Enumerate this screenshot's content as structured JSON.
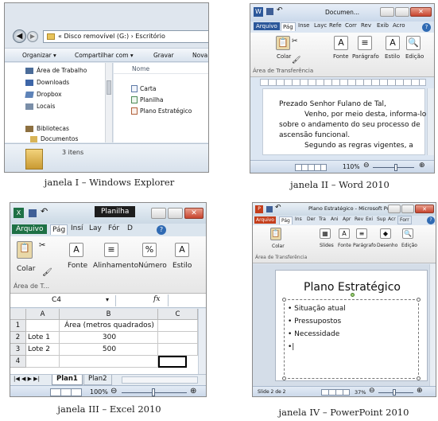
{
  "explorer": {
    "address": "« Disco removível (G:) › Escritório",
    "toolbar": [
      "Organizar ▾",
      "Compartilhar com ▾",
      "Gravar",
      "Nova"
    ],
    "nav": [
      "Área de Trabalho",
      "Downloads",
      "Dropbox",
      "Locais"
    ],
    "nav_libraries": "Bibliotecas",
    "nav_documents": "Documentos",
    "column_name": "Nome",
    "files": [
      "Carta",
      "Planilha",
      "Plano Estratégico"
    ],
    "status": "3 itens",
    "caption": "janela I – Windows Explorer"
  },
  "word": {
    "title": "Documen...",
    "tabs": [
      "Arquivo",
      "Pág",
      "Inse",
      "Layc",
      "Refe",
      "Corr",
      "Rev",
      "Exib",
      "Acro"
    ],
    "ribbon": {
      "paste": "Colar",
      "font": "Fonte",
      "paragraph": "Parágrafo",
      "style": "Estilo",
      "edit": "Edição",
      "clipboard": "Área de Transferência"
    },
    "body_lines": [
      "Prezado Senhor Fulano de Tal,",
      "Venho, por meio desta, informa-lo",
      "sobre o andamento do seu processo de",
      "ascensão funcional.",
      "Segundo as regras vigentes, a"
    ],
    "zoom": "110%",
    "caption": "janela II – Word 2010"
  },
  "excel": {
    "title": "Planilha",
    "tabs": [
      "Arquivo",
      "Pág",
      "Insí",
      "Lay",
      "Fór",
      "D"
    ],
    "ribbon": {
      "paste": "Colar",
      "font": "Fonte",
      "alignment": "Alinhamento",
      "number": "Número",
      "style": "Estilo",
      "clipboard": "Área de T..."
    },
    "namebox": "C4",
    "fx": "fx",
    "columns": [
      "A",
      "B",
      "C"
    ],
    "rows": [
      {
        "n": "1",
        "a": "",
        "b": "Área (metros quadrados)",
        "c": ""
      },
      {
        "n": "2",
        "a": "Lote 1",
        "b": "300",
        "c": ""
      },
      {
        "n": "3",
        "a": "Lote 2",
        "b": "500",
        "c": ""
      },
      {
        "n": "4",
        "a": "",
        "b": "",
        "c": ""
      }
    ],
    "sheets": [
      "Plan1",
      "Plan2"
    ],
    "zoom": "100%",
    "caption": "janela III – Excel 2010"
  },
  "ppt": {
    "title": "Plano Estratégico - Microsoft Po...",
    "tabs": [
      "Arquivo",
      "Pág",
      "Ins",
      "Der",
      "Tra",
      "Ani",
      "Apr",
      "Rev",
      "Exi",
      "Sup",
      "Acr",
      "Forr"
    ],
    "ribbon": {
      "paste": "Colar",
      "slides": "Slides",
      "font": "Fonte",
      "paragraph": "Parágrafo",
      "drawing": "Desenho",
      "edit": "Edição",
      "clipboard": "Área de Transferência"
    },
    "slide_title": "Plano Estratégico",
    "bullets": [
      "Situação atual",
      "Pressupostos",
      "Necessidade"
    ],
    "status": "Slide 2 de 2",
    "zoom": "37%",
    "caption": "janela IV – PowerPoint 2010"
  }
}
